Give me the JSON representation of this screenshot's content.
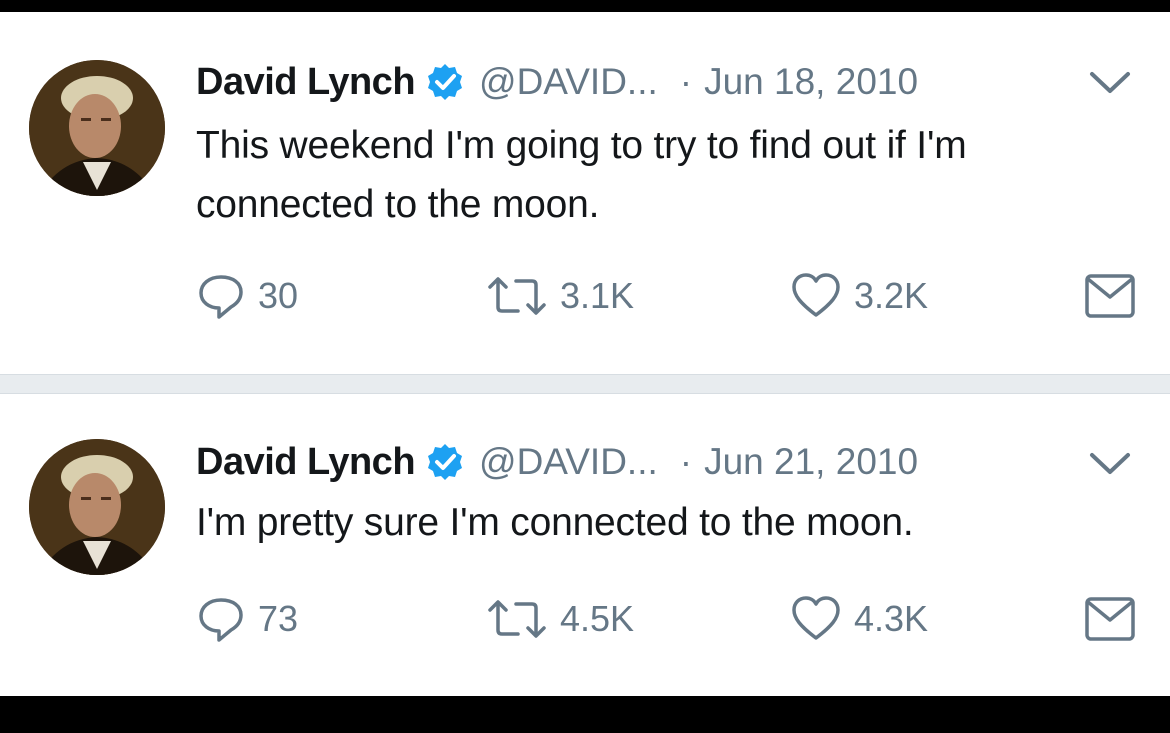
{
  "tweets": [
    {
      "author_name": "David Lynch",
      "handle": "@DAVID...",
      "separator": "·",
      "date": "Jun 18, 2010",
      "text": "This weekend I'm going to try to find out if I'm connected to the moon.",
      "replies": "30",
      "retweets": "3.1K",
      "likes": "3.2K",
      "avatar_icon": "avatar-photo",
      "verified_icon": "verified-badge-icon"
    },
    {
      "author_name": "David Lynch",
      "handle": "@DAVID...",
      "separator": "·",
      "date": "Jun 21, 2010",
      "text": "I'm pretty sure I'm connected to the moon.",
      "replies": "73",
      "retweets": "4.5K",
      "likes": "4.3K",
      "avatar_icon": "avatar-photo",
      "verified_icon": "verified-badge-icon"
    }
  ],
  "colors": {
    "name": "#14171a",
    "meta": "#657786",
    "verified": "#1da1f2",
    "background": "#ffffff",
    "divider": "#e8ecef"
  }
}
